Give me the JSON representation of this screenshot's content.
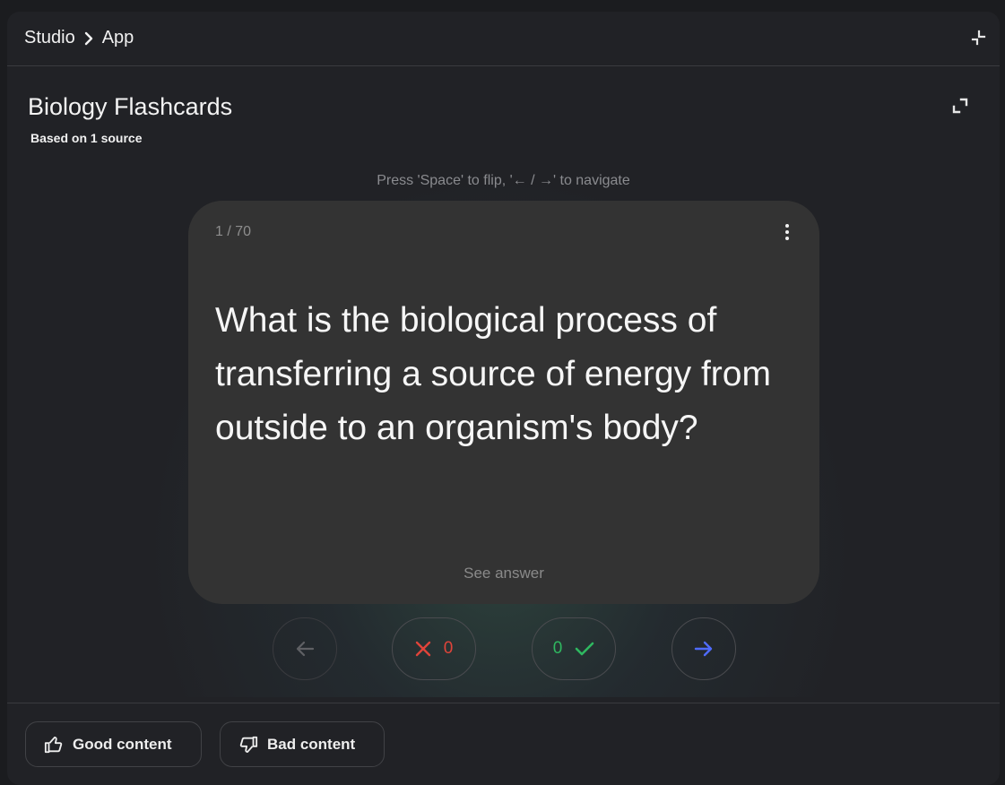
{
  "breadcrumb": {
    "root": "Studio",
    "current": "App"
  },
  "deck": {
    "title": "Biology Flashcards",
    "subtitle": "Based on 1 source"
  },
  "hint": "Press 'Space' to flip, '← / →' to navigate",
  "card": {
    "counter": "1 / 70",
    "question": "What is the biological process of transferring a source of energy from outside to an organism's body?",
    "see_answer": "See answer"
  },
  "controls": {
    "wrong_count": "0",
    "right_count": "0"
  },
  "feedback": {
    "good_label": "Good content",
    "bad_label": "Bad content"
  },
  "icons": {
    "breadcrumb_separator": "chevron-right-icon",
    "collapse": "collapse-icon",
    "expand": "expand-icon",
    "menu": "more-vert-icon",
    "prev": "arrow-left-icon",
    "wrong": "close-icon",
    "right": "check-icon",
    "next": "arrow-right-icon",
    "good": "thumb-up-icon",
    "bad": "thumb-down-icon"
  },
  "colors": {
    "wrong": "#e0443a",
    "right": "#2fb860",
    "next_arrow": "#4f6bff"
  }
}
